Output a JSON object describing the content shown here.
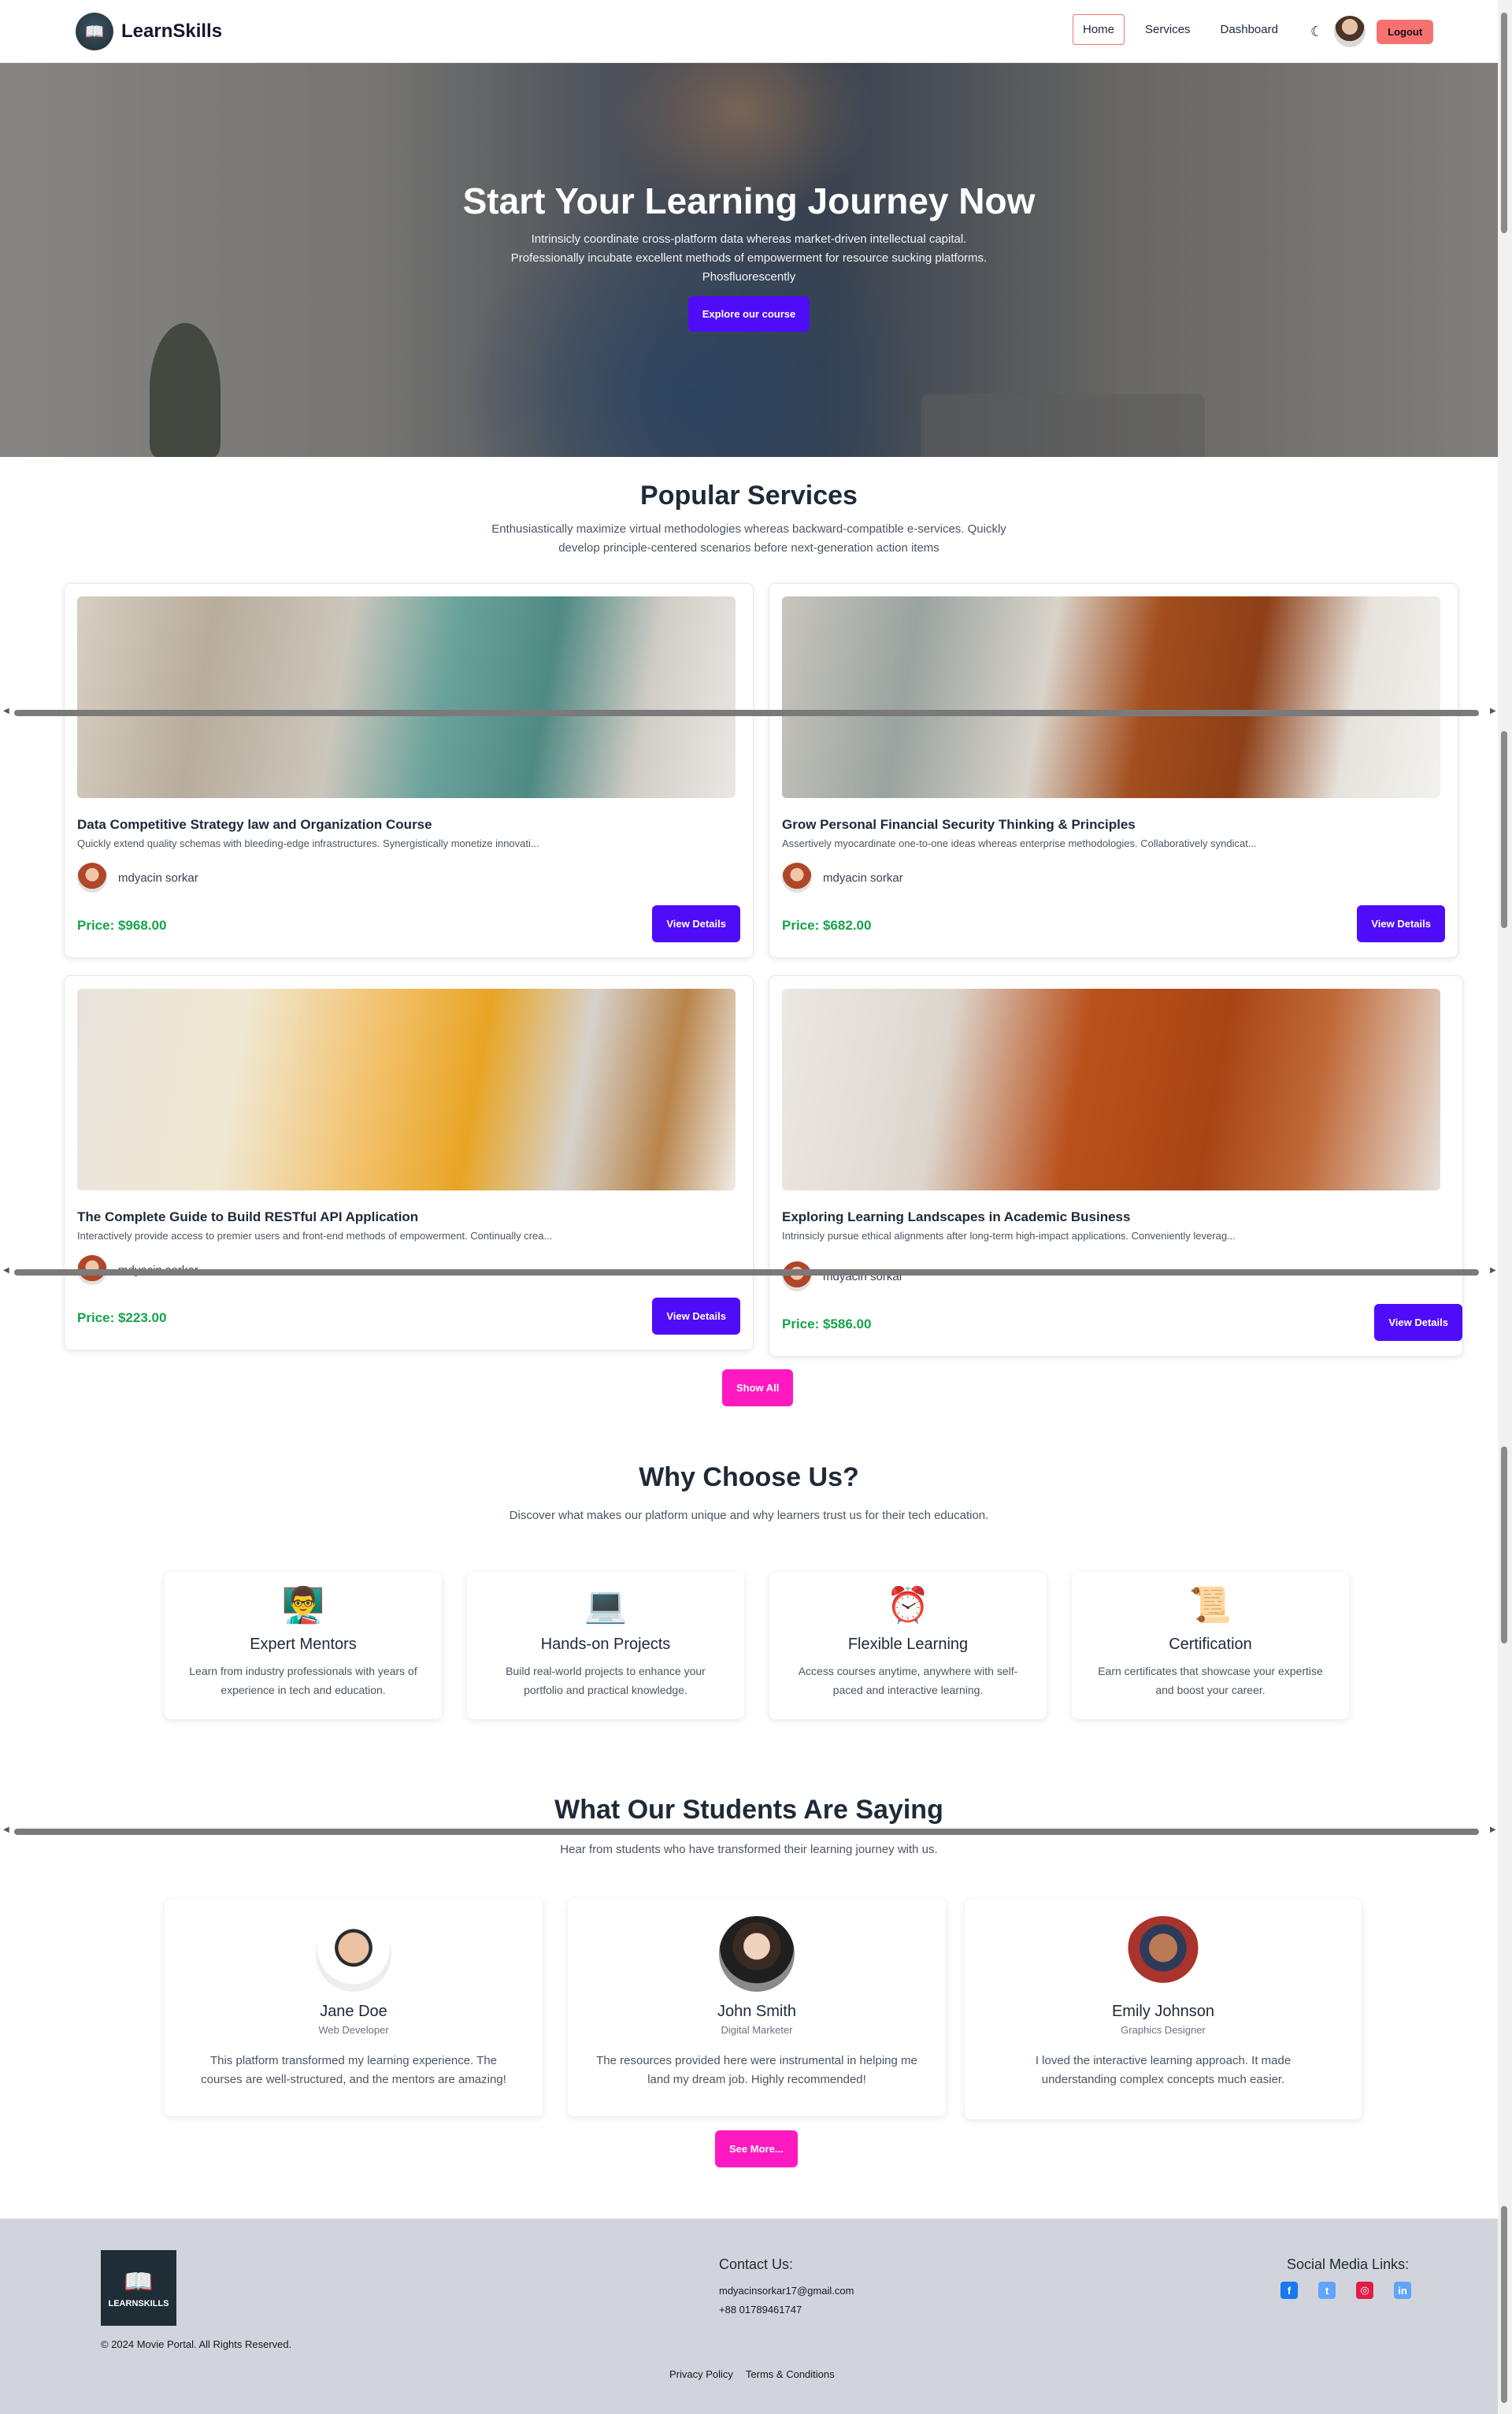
{
  "nav": {
    "brand": "LearnSkills",
    "links": [
      "Home",
      "Services",
      "Dashboard"
    ],
    "active": "Home",
    "logout": "Logout"
  },
  "hero": {
    "title": "Start Your Learning Journey Now",
    "subtitle": "Intrinsicly coordinate cross-platform data whereas market-driven intellectual capital. Professionally incubate excellent methods of empowerment for resource sucking platforms. Phosfluorescently",
    "cta": "Explore our course"
  },
  "services": {
    "title": "Popular Services",
    "subtitle": "Enthusiastically maximize virtual methodologies whereas backward-compatible e-services. Quickly develop principle-centered scenarios before next-generation action items",
    "show_all": "Show All",
    "cards": [
      {
        "title": "Data Competitive Strategy law and Organization Course",
        "desc": "Quickly extend quality schemas with bleeding-edge infrastructures. Synergistically monetize innovati...",
        "author": "mdyacin sorkar",
        "price": "Price: $968.00",
        "button": "View Details"
      },
      {
        "title": "Grow Personal Financial Security Thinking & Principles",
        "desc": "Assertively myocardinate one-to-one ideas whereas enterprise methodologies. Collaboratively syndicat...",
        "author": "mdyacin sorkar",
        "price": "Price: $682.00",
        "button": "View Details"
      },
      {
        "title": "The Complete Guide to Build RESTful API Application",
        "desc": "Interactively provide access to premier users and front-end methods of empowerment. Continually crea...",
        "author": "mdyacin sorkar",
        "price": "Price: $223.00",
        "button": "View Details"
      },
      {
        "title": "Exploring Learning Landscapes in Academic Business",
        "desc": "Intrinsicly pursue ethical alignments after long-term high-impact applications. Conveniently leverag...",
        "author": "mdyacin sorkar",
        "price": "Price: $586.00",
        "button": "View Details"
      }
    ]
  },
  "why": {
    "title": "Why Choose Us?",
    "subtitle": "Discover what makes our platform unique and why learners trust us for their tech education.",
    "features": [
      {
        "icon": "mentor-icon",
        "glyph": "👨‍🏫",
        "title": "Expert Mentors",
        "desc": "Learn from industry professionals with years of experience in tech and education."
      },
      {
        "icon": "laptop-icon",
        "glyph": "💻",
        "title": "Hands-on Projects",
        "desc": "Build real-world projects to enhance your portfolio and practical knowledge."
      },
      {
        "icon": "alarm-clock-icon",
        "glyph": "⏰",
        "title": "Flexible Learning",
        "desc": "Access courses anytime, anywhere with self-paced and interactive learning."
      },
      {
        "icon": "scroll-icon",
        "glyph": "📜",
        "title": "Certification",
        "desc": "Earn certificates that showcase your expertise and boost your career."
      }
    ]
  },
  "testimonials": {
    "title": "What Our Students Are Saying",
    "subtitle": "Hear from students who have transformed their learning journey with us.",
    "see_more": "See More...",
    "items": [
      {
        "name": "Jane Doe",
        "role": "Web Developer",
        "quote": "This platform transformed my learning experience. The courses are well-structured, and the mentors are amazing!"
      },
      {
        "name": "John Smith",
        "role": "Digital Marketer",
        "quote": "The resources provided here were instrumental in helping me land my dream job. Highly recommended!"
      },
      {
        "name": "Emily Johnson",
        "role": "Graphics Designer",
        "quote": "I loved the interactive learning approach. It made understanding complex concepts much easier."
      }
    ]
  },
  "footer": {
    "logo_text": "LEARNSKILLS",
    "copyright": "© 2024 Movie Portal. All Rights Reserved.",
    "contact_title": "Contact Us:",
    "email": "mdyacinsorkar17@gmail.com",
    "phone": "+88 01789461747",
    "social_title": "Social Media Links:",
    "links": [
      "Privacy Policy",
      "Terms & Conditions"
    ]
  },
  "colors": {
    "primary": "#4f0cf8",
    "accent_pink": "#ff19c1",
    "logout_red": "#f87171",
    "price_green": "#16a34a",
    "footer_bg": "#d1d5db"
  }
}
